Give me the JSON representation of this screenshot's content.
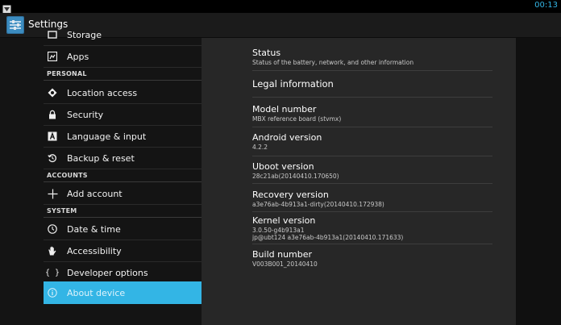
{
  "status_bar": {
    "time": "00:13",
    "notification_icon": "android-notification-icon"
  },
  "action_bar": {
    "title": "Settings",
    "app_icon": "settings-app-icon"
  },
  "sidebar": {
    "cut_item": {
      "label": "Storage",
      "icon": "storage-icon"
    },
    "apps": {
      "label": "Apps",
      "icon": "apps-icon"
    },
    "header_personal": "PERSONAL",
    "location": {
      "label": "Location access",
      "icon": "location-icon"
    },
    "security": {
      "label": "Security",
      "icon": "lock-icon"
    },
    "language": {
      "label": "Language & input",
      "icon": "keyboard-icon"
    },
    "backup": {
      "label": "Backup & reset",
      "icon": "backup-icon"
    },
    "header_accounts": "ACCOUNTS",
    "add_account": {
      "label": "Add account",
      "icon": "plus-icon"
    },
    "header_system": "SYSTEM",
    "datetime": {
      "label": "Date & time",
      "icon": "clock-icon"
    },
    "accessibility": {
      "label": "Accessibility",
      "icon": "hand-icon"
    },
    "developer": {
      "label": "Developer options",
      "icon": "braces-icon"
    },
    "about": {
      "label": "About device",
      "icon": "info-icon"
    }
  },
  "about": {
    "status": {
      "title": "Status",
      "summary": "Status of the battery, network, and other information"
    },
    "legal": {
      "title": "Legal information"
    },
    "model": {
      "title": "Model number",
      "summary": "MBX reference board (stvmx)"
    },
    "android": {
      "title": "Android version",
      "summary": "4.2.2"
    },
    "uboot": {
      "title": "Uboot version",
      "summary": "28c21ab(20140410.170650)"
    },
    "recovery": {
      "title": "Recovery version",
      "summary": "a3e76ab-4b913a1-dirty(20140410.172938)"
    },
    "kernel": {
      "title": "Kernel version",
      "summary_line1": "3.0.50-g4b913a1",
      "summary_line2": "jp@ubt124 a3e76ab-4b913a1(20140410.171633)"
    },
    "build": {
      "title": "Build number",
      "summary": "V003B001_20140410"
    }
  },
  "colors": {
    "accent": "#33b5e5",
    "background": "#000000",
    "detail_pane": "#272727",
    "list_pane": "#141414"
  }
}
